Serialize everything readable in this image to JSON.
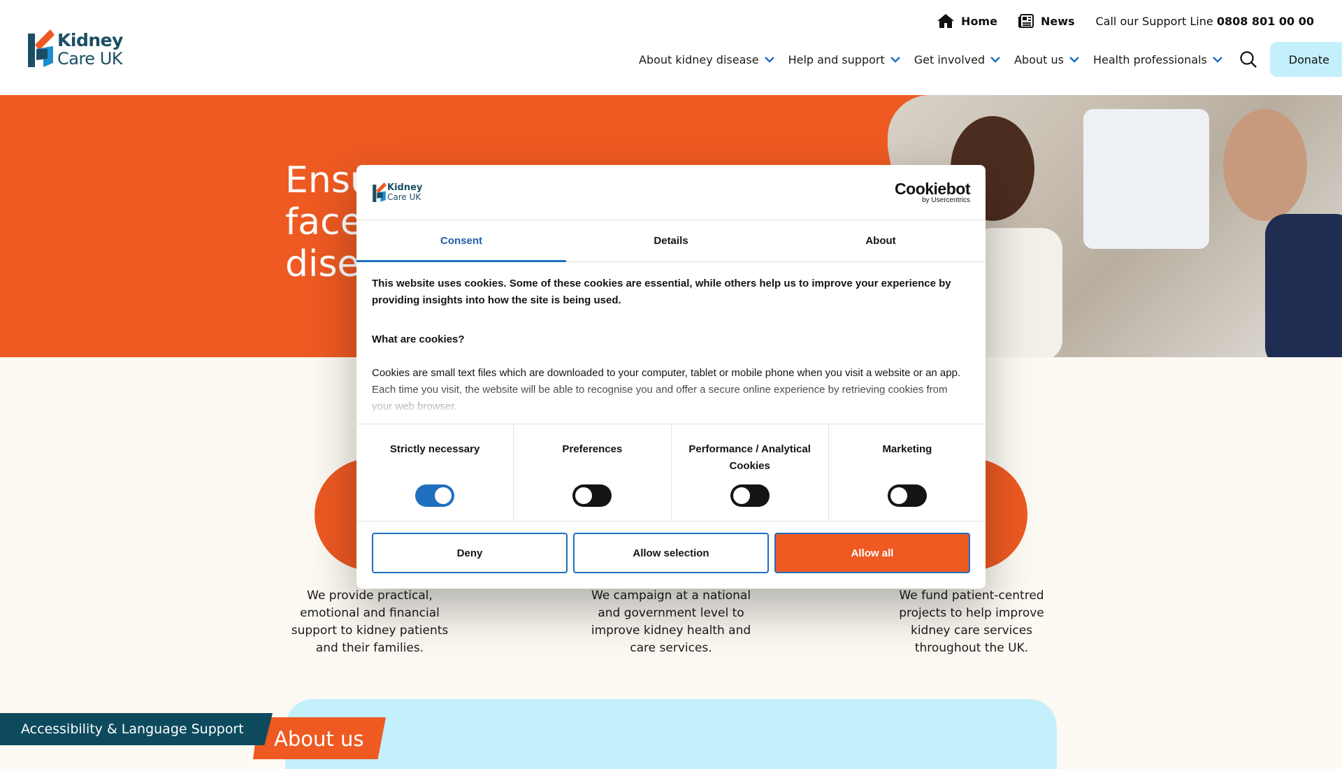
{
  "header": {
    "logo_line1": "Kidney",
    "logo_line2": "Care UK",
    "utility": {
      "home_label": "Home",
      "news_label": "News",
      "support_prefix": "Call our Support Line",
      "support_number": "0808 801 00 00"
    },
    "nav": [
      {
        "label": "About kidney disease"
      },
      {
        "label": "Help and support"
      },
      {
        "label": "Get involved"
      },
      {
        "label": "About us"
      },
      {
        "label": "Health professionals"
      }
    ],
    "donate_label": "Donate"
  },
  "hero": {
    "title_line1": "Ensu",
    "title_line2": "faces",
    "title_line3": "disea"
  },
  "cards": [
    {
      "text": "We provide practical, emotional and financial support to kidney patients and their families."
    },
    {
      "text": "We campaign at a national and government level to improve kidney health and care services."
    },
    {
      "text": "We fund patient-centred projects to help improve kidney care services throughout the UK."
    }
  ],
  "about_section": {
    "title": "About us"
  },
  "accessibility_label": "Accessibility & Language Support",
  "cookie_dialog": {
    "logo_line1": "Kidney",
    "logo_line2": "Care UK",
    "brand_name": "Cookiebot",
    "brand_by": "by Usercentrics",
    "tabs": [
      {
        "label": "Consent",
        "active": true
      },
      {
        "label": "Details",
        "active": false
      },
      {
        "label": "About",
        "active": false
      }
    ],
    "intro": "This website uses cookies. Some of these cookies are essential, while others help us to improve your experience by providing insights into how the site is being used.",
    "question": "What are cookies?",
    "body": "Cookies are small text files which are downloaded to your computer, tablet or mobile phone when you visit a website or an app. Each time you visit, the website will be able to recognise you and offer a secure online experience by retrieving cookies from your web browser.",
    "preferences": [
      {
        "label": "Strictly necessary",
        "enabled": true
      },
      {
        "label": "Preferences",
        "enabled": false
      },
      {
        "label": "Performance / Analytical Cookies",
        "enabled": false
      },
      {
        "label": "Marketing",
        "enabled": false
      }
    ],
    "buttons": {
      "deny": "Deny",
      "allow_selection": "Allow selection",
      "allow_all": "Allow all"
    }
  },
  "colors": {
    "brand_orange": "#ee5a22",
    "brand_teal": "#1b4e63",
    "donate_bg": "#c4f0fc",
    "toggle_on": "#1f6fbf"
  }
}
